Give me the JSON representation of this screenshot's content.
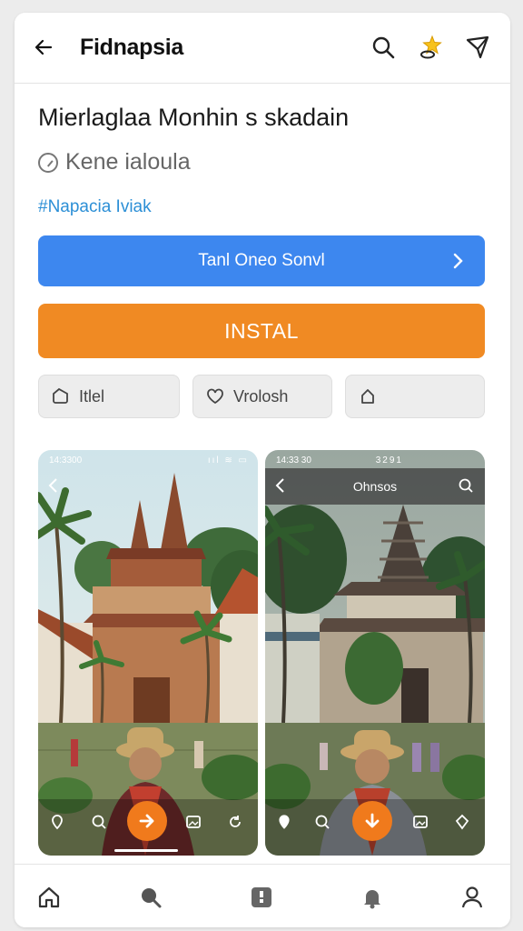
{
  "header": {
    "title": "Fidnapsia",
    "icons": [
      "back-arrow-icon",
      "search-icon",
      "trophy-star-icon",
      "send-icon"
    ]
  },
  "app": {
    "name": "Mierlaglaa Monhin s skadain",
    "developer": "Kene ialoula",
    "tag": "#Napacia  Iviak"
  },
  "actions": {
    "primary_label": "Tanl Oneo Sonvl",
    "install_label": "INSTAL"
  },
  "chips": [
    {
      "label": "Itlel",
      "icon": "tag-icon"
    },
    {
      "label": "Vrolosh",
      "icon": "heart-icon"
    },
    {
      "label": "",
      "icon": "share-icon"
    }
  ],
  "screenshots": [
    {
      "status_left": "14:3300",
      "status_right": "ııl ≋ ▭",
      "bar_title": ""
    },
    {
      "status_left": "14:33 30",
      "status_right": "3291",
      "bar_title": "Ohnsos"
    }
  ],
  "bottom_nav": [
    "home-icon",
    "search-icon",
    "apps-icon",
    "notifications-icon",
    "profile-icon"
  ],
  "colors": {
    "primary": "#3d87ef",
    "install": "#f08a23",
    "link": "#2c8fd6"
  }
}
